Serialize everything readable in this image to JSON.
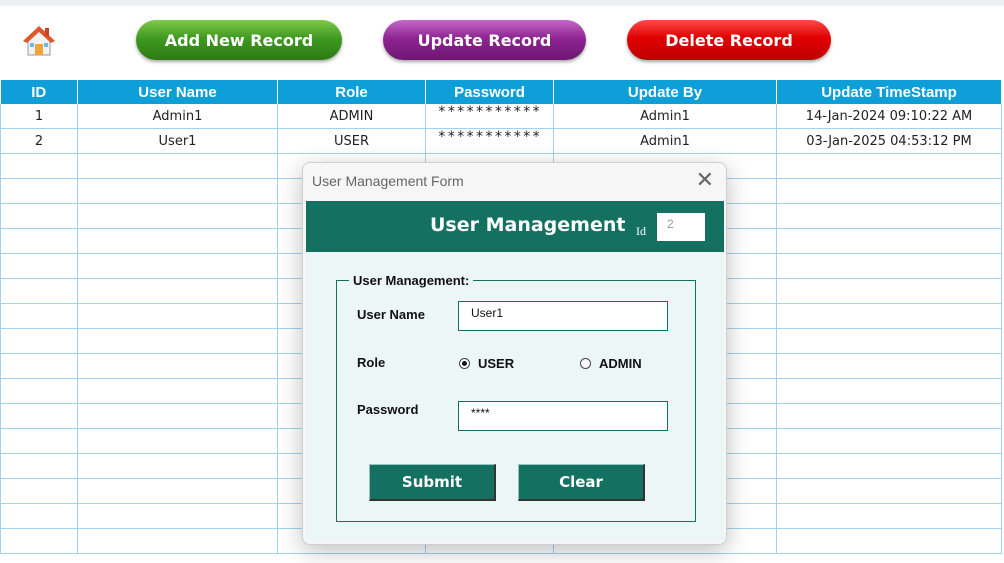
{
  "toolbar": {
    "home_icon": "home-icon",
    "add_label": "Add New Record",
    "update_label": "Update Record",
    "delete_label": "Delete Record",
    "colors": {
      "add": "#3f9a1f",
      "update": "#8e2592",
      "delete": "#e00000"
    }
  },
  "table": {
    "header_color": "#0f9fd8",
    "columns": [
      "ID",
      "User Name",
      "Role",
      "Password",
      "Update By",
      "Update TimeStamp"
    ],
    "rows": [
      [
        "1",
        "Admin1",
        "ADMIN",
        "***********",
        "Admin1",
        "14-Jan-2024 09:10:22 AM"
      ],
      [
        "2",
        "User1",
        "USER",
        "***********",
        "Admin1",
        "03-Jan-2025 04:53:12 PM"
      ]
    ]
  },
  "dialog": {
    "window_title": "User Management Form",
    "close_icon": "close-icon",
    "banner_title": "User Management",
    "banner_color": "#147060",
    "id_label": "Id",
    "id_value": "2",
    "group_label": "User Management:",
    "username_label": "User Name",
    "username_value": "User1",
    "role_label": "Role",
    "role_options": [
      "USER",
      "ADMIN"
    ],
    "role_selected": "USER",
    "password_label": "Password",
    "password_value": "****",
    "submit_label": "Submit",
    "clear_label": "Clear"
  }
}
